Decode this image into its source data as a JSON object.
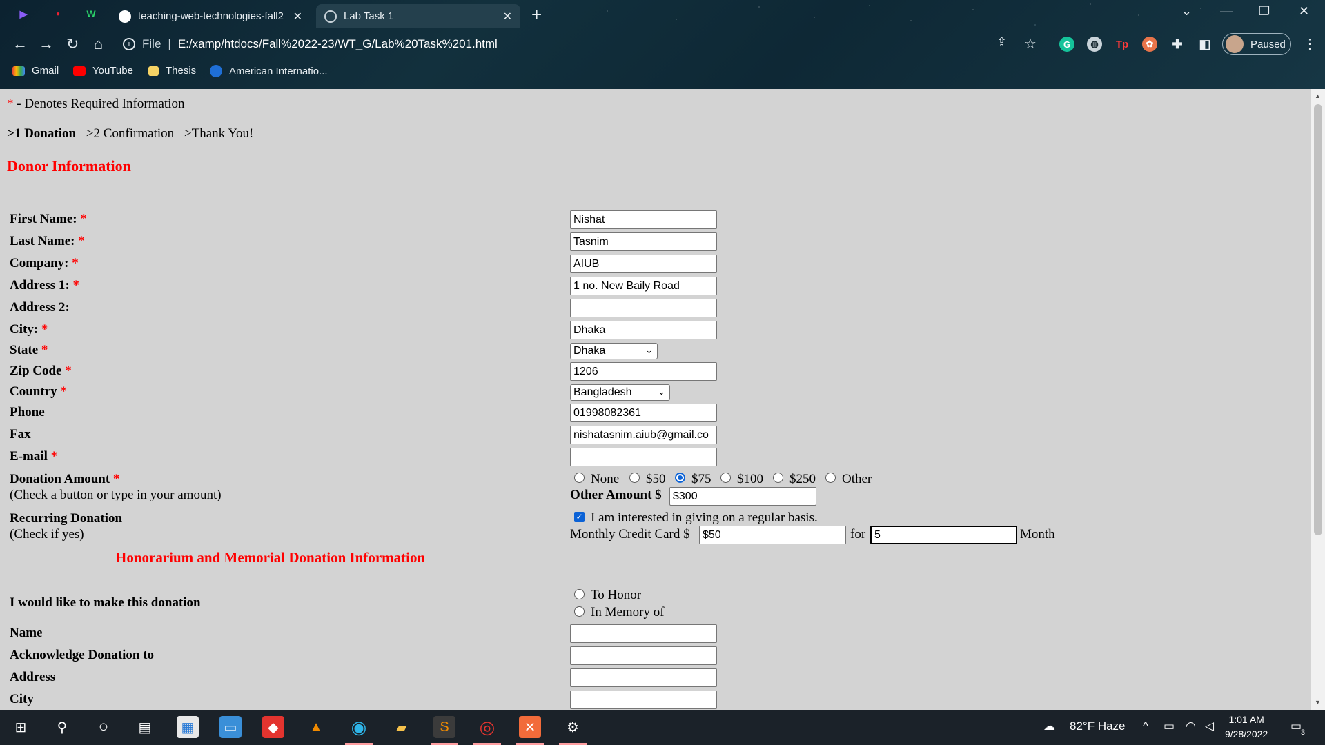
{
  "browser": {
    "tabs": [
      {
        "label": "teaching-web-technologies-fall2"
      },
      {
        "label": "Lab Task 1"
      }
    ],
    "address": {
      "scheme": "File",
      "url": "E:/xamp/htdocs/Fall%2022-23/WT_G/Lab%20Task%201.html"
    },
    "profile_label": "Paused",
    "bookmarks": [
      "Gmail",
      "YouTube",
      "Thesis",
      "American Internatio..."
    ]
  },
  "form": {
    "required_note": "- Denotes Required Information",
    "star": "*",
    "steps": [
      ">1 Donation",
      ">2 Confirmation",
      ">Thank You!"
    ],
    "donor_heading": "Donor Information",
    "fields": {
      "first_name": {
        "label": "First Name:",
        "value": "Nishat"
      },
      "last_name": {
        "label": "Last Name:",
        "value": "Tasnim"
      },
      "company": {
        "label": "Company:",
        "value": "AIUB"
      },
      "address1": {
        "label": "Address 1:",
        "value": "1 no. New Baily Road"
      },
      "address2": {
        "label": "Address 2:",
        "value": ""
      },
      "city": {
        "label": "City:",
        "value": "Dhaka"
      },
      "state": {
        "label": "State",
        "value": "Dhaka"
      },
      "zip": {
        "label": "Zip Code",
        "value": "1206"
      },
      "country": {
        "label": "Country",
        "value": "Bangladesh"
      },
      "phone": {
        "label": "Phone",
        "value": "01998082361"
      },
      "fax": {
        "label": "Fax",
        "value": "nishatasnim.aiub@gmail.co"
      },
      "email": {
        "label": "E-mail",
        "value": ""
      }
    },
    "donation": {
      "label": "Donation Amount",
      "hint": "(Check a button or type in your amount)",
      "options": [
        "None",
        "$50",
        "$75",
        "$100",
        "$250",
        "Other"
      ],
      "selected": "$75",
      "other_label": "Other Amount $",
      "other_value": "$300"
    },
    "recurring": {
      "label": "Recurring Donation",
      "hint": "(Check if yes)",
      "checkbox_label": "I am interested in giving on a regular basis.",
      "checked": true,
      "monthly_label": "Monthly Credit Card $",
      "monthly_value": "$50",
      "for_label": "for",
      "months_value": "5",
      "month_label": "Month"
    },
    "honor_heading": "Honorarium and Memorial Donation Information",
    "honor": {
      "label": "I would like to make this donation",
      "options": [
        "To Honor",
        "In Memory of"
      ],
      "name_label": "Name",
      "ack_label": "Acknowledge Donation to",
      "address_label": "Address",
      "city_label": "City"
    }
  },
  "taskbar": {
    "weather": "82°F  Haze",
    "time": "1:01 AM",
    "date": "9/28/2022",
    "notif_count": "3"
  }
}
